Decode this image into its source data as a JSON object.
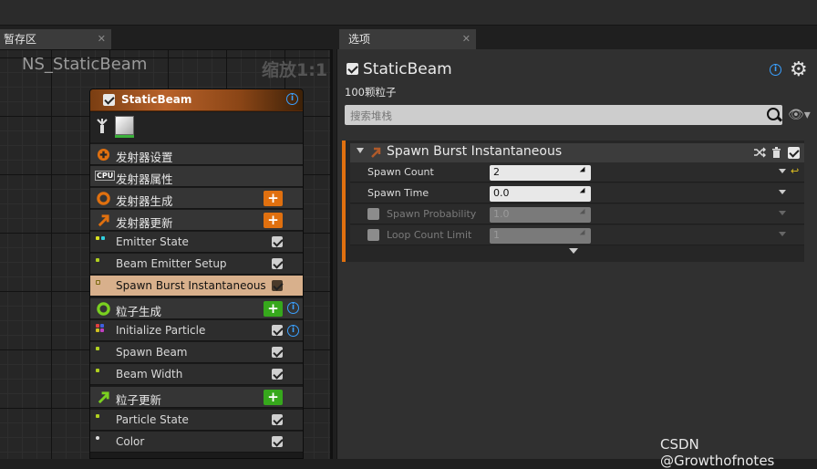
{
  "tabs": {
    "left": {
      "label": "暂存区",
      "close": "✕"
    },
    "right": {
      "label": "选项",
      "close": "✕"
    }
  },
  "graph": {
    "title": "NS_StaticBeam",
    "zoom": "缩放1:1"
  },
  "node": {
    "title": "StaticBeam",
    "rows": [
      {
        "label": "发射器设置",
        "kind": "section"
      },
      {
        "label": "发射器属性",
        "kind": "section"
      },
      {
        "label": "发射器生成",
        "kind": "section"
      },
      {
        "label": "发射器更新",
        "kind": "section"
      },
      {
        "label": "Emitter State",
        "kind": "module"
      },
      {
        "label": "Beam Emitter Setup",
        "kind": "module"
      },
      {
        "label": "Spawn Burst Instantaneous",
        "kind": "module",
        "selected": true
      },
      {
        "label": "粒子生成",
        "kind": "section"
      },
      {
        "label": "Initialize Particle",
        "kind": "module"
      },
      {
        "label": "Spawn Beam",
        "kind": "module"
      },
      {
        "label": "Beam Width",
        "kind": "module"
      },
      {
        "label": "粒子更新",
        "kind": "section"
      },
      {
        "label": "Particle State",
        "kind": "module"
      },
      {
        "label": "Color",
        "kind": "module"
      }
    ],
    "plus_label": "+",
    "cpu_label": "CPU"
  },
  "details": {
    "title": "StaticBeam",
    "subtitle": "100颗粒子",
    "search_placeholder": "搜索堆栈",
    "module_name": "Spawn Burst Instantaneous",
    "params": [
      {
        "label": "Spawn Count",
        "value": "2",
        "enabled": true
      },
      {
        "label": "Spawn Time",
        "value": "0.0",
        "enabled": true
      },
      {
        "label": "Spawn Probability",
        "value": "1.0",
        "enabled": false
      },
      {
        "label": "Loop Count Limit",
        "value": "1",
        "enabled": false
      }
    ]
  },
  "watermark": "CSDN @Growthofnotes",
  "colors": {
    "accent_orange": "#e0700f",
    "accent_green": "#36a81c",
    "selected_row": "#d8b08c",
    "info_blue": "#3aa0ff"
  }
}
